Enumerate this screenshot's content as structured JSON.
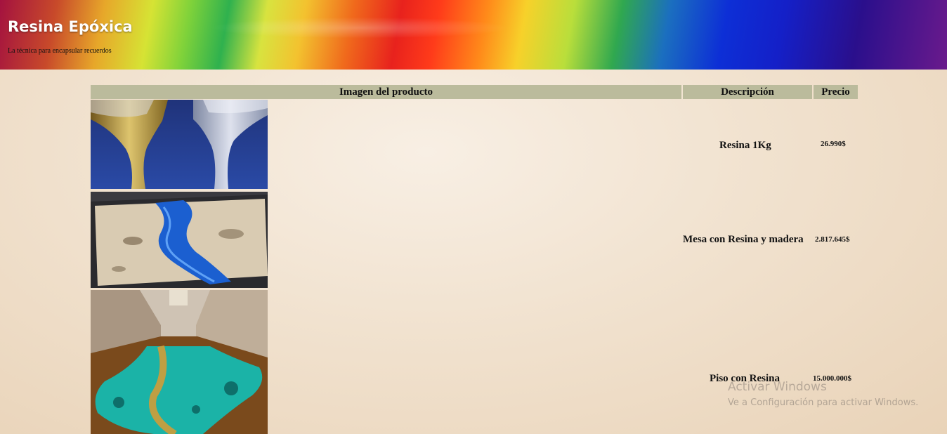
{
  "header": {
    "title": "Resina Epóxica",
    "subtitle": "La técnica para encapsular recuerdos"
  },
  "table": {
    "columns": [
      "Imagen del producto",
      "Descripción",
      "Precio"
    ],
    "rows": [
      {
        "image": "resin-pouring-image",
        "description": "Resina 1Kg",
        "price": "26.990$"
      },
      {
        "image": "resin-wood-table-image",
        "description": "Mesa con Resina y madera",
        "price": "2.817.645$"
      },
      {
        "image": "resin-floor-image",
        "description": "Piso con Resina",
        "price": "15.000.000$"
      }
    ]
  },
  "watermark": {
    "line1": "Activar Windows",
    "line2": "Ve a Configuración para activar Windows."
  },
  "colors": {
    "header_row": "#bbbb9c",
    "page_background": "#f1e2cf"
  }
}
